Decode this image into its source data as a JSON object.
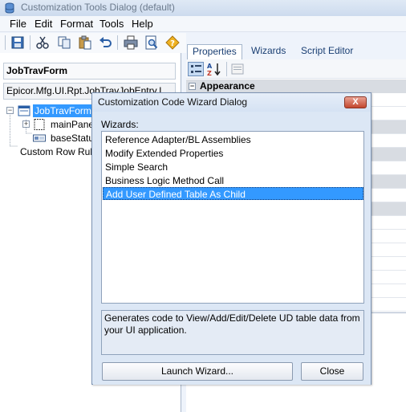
{
  "window": {
    "title": "Customization Tools Dialog (default)"
  },
  "menu": [
    "File",
    "Edit",
    "Format",
    "Tools",
    "Help"
  ],
  "toolbar_icons": [
    "save-icon",
    "cut-icon",
    "copy-icon",
    "paste-icon",
    "undo-icon",
    "print-icon",
    "print-preview-icon",
    "help-icon"
  ],
  "left_panel": {
    "form_name": "JobTravForm",
    "class_name": "Epicor.Mfg.UI.Rpt.JobTravJobEntry.I",
    "tree": [
      {
        "label": "JobTravForm",
        "icon": "form-icon",
        "expander": "−"
      },
      {
        "label": "mainPanel",
        "icon": "panel-icon",
        "expander": "+"
      },
      {
        "label": "baseStatus",
        "icon": "statusbar-icon",
        "expander": ""
      },
      {
        "label": "Custom Row Rules",
        "icon": "",
        "expander": ""
      }
    ]
  },
  "right_panel": {
    "tabs": [
      "Properties",
      "Wizards",
      "Script Editor"
    ],
    "active_tab": "Properties",
    "category": "Appearance"
  },
  "dialog": {
    "title": "Customization Code Wizard Dialog",
    "close_label": "X",
    "wizards_label": "Wizards:",
    "wizards": [
      "Reference Adapter/BL Assemblies",
      "Modify Extended Properties",
      "Simple Search",
      "Business Logic Method Call",
      "Add User Defined Table As Child"
    ],
    "selected_index": 4,
    "description": "Generates code to View/Add/Edit/Delete UD table data from your UI application.",
    "launch_button": "Launch Wizard...",
    "close_button": "Close"
  },
  "colors": {
    "selection": "#3399ff",
    "dialog_background": "#dce7f5",
    "close_button": "#c3462e"
  }
}
